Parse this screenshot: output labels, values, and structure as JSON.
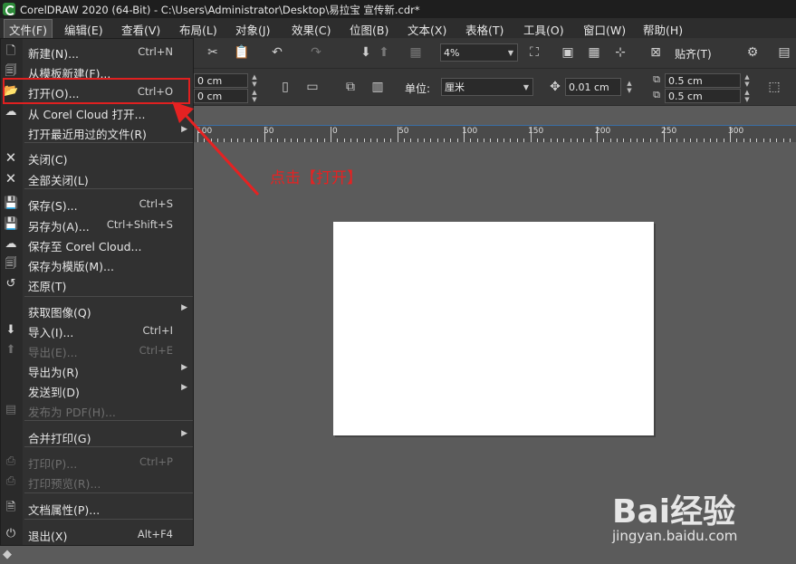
{
  "window": {
    "title": "CorelDRAW 2020 (64-Bit) - C:\\Users\\Administrator\\Desktop\\易拉宝 宣传新.cdr*"
  },
  "menubar": {
    "items": [
      {
        "label": "文件(F)"
      },
      {
        "label": "编辑(E)"
      },
      {
        "label": "查看(V)"
      },
      {
        "label": "布局(L)"
      },
      {
        "label": "对象(J)"
      },
      {
        "label": "效果(C)"
      },
      {
        "label": "位图(B)"
      },
      {
        "label": "文本(X)"
      },
      {
        "label": "表格(T)"
      },
      {
        "label": "工具(O)"
      },
      {
        "label": "窗口(W)"
      },
      {
        "label": "帮助(H)"
      }
    ]
  },
  "toolbar1": {
    "zoom": "4%",
    "snap_label": "贴齐(T)"
  },
  "toolbar2": {
    "width_value": "0 cm",
    "height_value": "0 cm",
    "unit_label": "单位:",
    "unit_value": "厘米",
    "nudge_value": "0.01 cm",
    "dup_x": "0.5 cm",
    "dup_y": "0.5 cm"
  },
  "ruler": {
    "labels": [
      "100",
      "50",
      "0",
      "50",
      "100",
      "150",
      "200",
      "250",
      "300"
    ]
  },
  "file_menu": {
    "items": [
      {
        "label": "新建(N)...",
        "shortcut": "Ctrl+N",
        "icon": "new-doc-icon",
        "disabled": false,
        "submenu": false
      },
      {
        "label": "从模板新建(F)...",
        "shortcut": "",
        "icon": "new-template-icon",
        "disabled": false,
        "submenu": false
      },
      {
        "label": "打开(O)...",
        "shortcut": "Ctrl+O",
        "icon": "folder-open-icon",
        "disabled": false,
        "submenu": false
      },
      {
        "label": "从 Corel Cloud 打开...",
        "shortcut": "",
        "icon": "cloud-open-icon",
        "disabled": false,
        "submenu": false
      },
      {
        "label": "打开最近用过的文件(R)",
        "shortcut": "",
        "icon": "",
        "disabled": false,
        "submenu": true
      },
      {
        "label": "关闭(C)",
        "shortcut": "",
        "icon": "close-doc-icon",
        "disabled": false,
        "submenu": false
      },
      {
        "label": "全部关闭(L)",
        "shortcut": "",
        "icon": "close-all-icon",
        "disabled": false,
        "submenu": false
      },
      {
        "label": "保存(S)...",
        "shortcut": "Ctrl+S",
        "icon": "save-icon",
        "disabled": false,
        "submenu": false
      },
      {
        "label": "另存为(A)...",
        "shortcut": "Ctrl+Shift+S",
        "icon": "save-as-icon",
        "disabled": false,
        "submenu": false
      },
      {
        "label": "保存至 Corel Cloud...",
        "shortcut": "",
        "icon": "cloud-save-icon",
        "disabled": false,
        "submenu": false
      },
      {
        "label": "保存为模版(M)...",
        "shortcut": "",
        "icon": "save-template-icon",
        "disabled": false,
        "submenu": false
      },
      {
        "label": "还原(T)",
        "shortcut": "",
        "icon": "revert-icon",
        "disabled": false,
        "submenu": false
      },
      {
        "label": "获取图像(Q)",
        "shortcut": "",
        "icon": "",
        "disabled": false,
        "submenu": true
      },
      {
        "label": "导入(I)...",
        "shortcut": "Ctrl+I",
        "icon": "import-icon",
        "disabled": false,
        "submenu": false
      },
      {
        "label": "导出(E)...",
        "shortcut": "Ctrl+E",
        "icon": "export-icon",
        "disabled": true,
        "submenu": false
      },
      {
        "label": "导出为(R)",
        "shortcut": "",
        "icon": "",
        "disabled": false,
        "submenu": true
      },
      {
        "label": "发送到(D)",
        "shortcut": "",
        "icon": "",
        "disabled": false,
        "submenu": true
      },
      {
        "label": "发布为 PDF(H)...",
        "shortcut": "",
        "icon": "pdf-icon",
        "disabled": true,
        "submenu": false
      },
      {
        "label": "合并打印(G)",
        "shortcut": "",
        "icon": "",
        "disabled": false,
        "submenu": true
      },
      {
        "label": "打印(P)...",
        "shortcut": "Ctrl+P",
        "icon": "print-icon",
        "disabled": true,
        "submenu": false
      },
      {
        "label": "打印预览(R)...",
        "shortcut": "",
        "icon": "print-preview-icon",
        "disabled": true,
        "submenu": false
      },
      {
        "label": "文档属性(P)...",
        "shortcut": "",
        "icon": "doc-properties-icon",
        "disabled": false,
        "submenu": false
      },
      {
        "label": "退出(X)",
        "shortcut": "Alt+F4",
        "icon": "power-icon",
        "disabled": false,
        "submenu": false
      }
    ]
  },
  "annotation": {
    "text": "点击【打开】",
    "color": "#e52222"
  },
  "watermark": {
    "brand": "Bai经验",
    "url": "jingyan.baidu.com"
  },
  "colors": {
    "menu_bg": "#313131",
    "canvas_bg": "#5b5b5b",
    "highlight": "#e02020"
  }
}
